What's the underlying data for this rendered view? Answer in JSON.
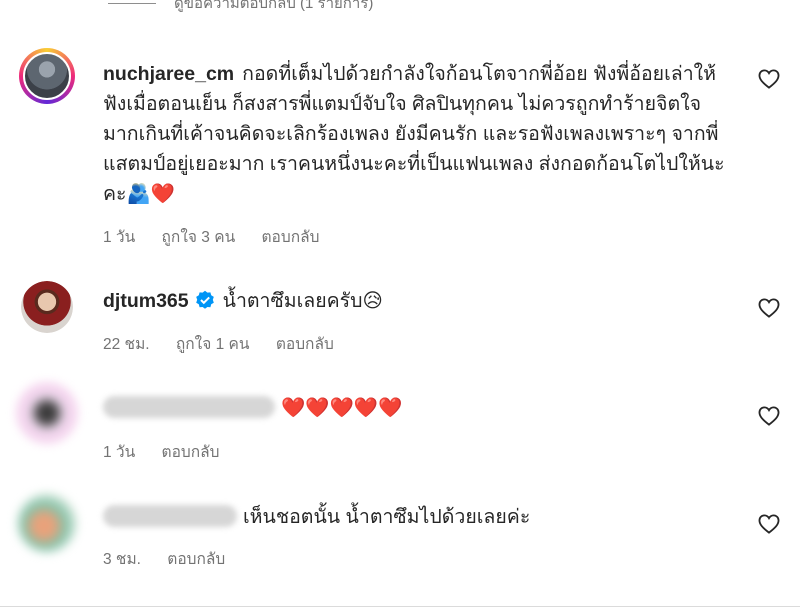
{
  "top": {
    "view_replies": "ดูข้อความตอบกลับ (1 รายการ)"
  },
  "comments": [
    {
      "username": "nuchjaree_cm",
      "text": "กอดที่เต็มไปด้วยกำลังใจก้อนโตจากพี่อ้อย ฟังพี่อ้อยเล่าให้ฟังเมื่อตอนเย็น ก็สงสารพี่แตมป์จับใจ ศิลปินทุกคน ไม่ควรถูกทำร้ายจิตใจมากเกินที่เค้าจนคิดจะเลิกร้องเพลง ยังมีคนรัก และรอฟังเพลงเพราะๆ จากพี่แสตมป์อยู่เยอะมาก เราคนหนึ่งนะคะที่เป็นแฟนเพลง ส่งกอดก้อนโตไปให้นะคะ🫂❤️",
      "time": "1 วัน",
      "likes": "ถูกใจ 3 คน",
      "reply": "ตอบกลับ"
    },
    {
      "username": "djtum365",
      "text": "น้ำตาซึมเลยครับ😥",
      "time": "22 ชม.",
      "likes": "ถูกใจ 1 คน",
      "reply": "ตอบกลับ"
    },
    {
      "text": "❤️❤️❤️❤️❤️",
      "time": "1 วัน",
      "reply": "ตอบกลับ"
    },
    {
      "text": "เห็นชอตนั้น น้ำตาซึมไปด้วยเลยค่ะ",
      "time": "3 ชม.",
      "reply": "ตอบกลับ"
    }
  ],
  "colors": {
    "verified": "#0095f6",
    "meta": "#737373",
    "text": "#262626"
  },
  "icons": {
    "like": "heart-outline-icon",
    "verified": "verified-badge-icon"
  }
}
